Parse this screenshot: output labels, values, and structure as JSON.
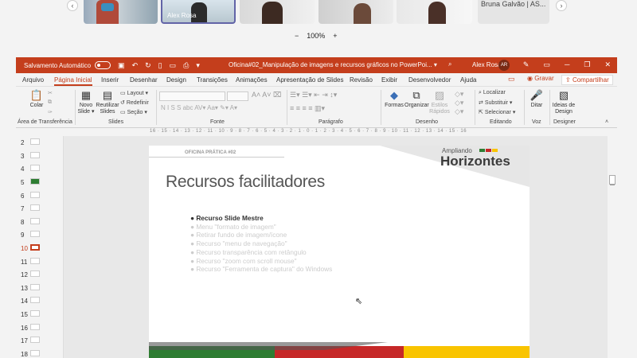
{
  "meeting": {
    "participants": [
      {
        "name": ""
      },
      {
        "name": "Alex Rosa"
      },
      {
        "name": ""
      },
      {
        "name": ""
      },
      {
        "name": ""
      },
      {
        "name": "Bruna Galvão | AS..."
      }
    ],
    "prev_arrow": "‹",
    "next_arrow": "›",
    "zoom_minus": "−",
    "zoom_level": "100%",
    "zoom_plus": "+"
  },
  "window": {
    "autosave_label": "Salvamento Automático",
    "document_title": "Oficina#02_Manipulação de imagens e recursos gráficos no PowerPoi... ▾",
    "user_name": "Alex Rosa",
    "user_initials": "AR"
  },
  "tabs": [
    "Arquivo",
    "Página Inicial",
    "Inserir",
    "Desenhar",
    "Design",
    "Transições",
    "Animações",
    "Apresentação de Slides",
    "Revisão",
    "Exibir",
    "Desenvolvedor",
    "Ajuda"
  ],
  "actions": {
    "record": "Gravar",
    "share": "Compartilhar"
  },
  "ribbon": {
    "paste": "Colar",
    "new_slide": "Novo Slide ▾",
    "reuse_slides": "Reutilizar Slides",
    "layout": "Layout ▾",
    "reset": "Redefinir",
    "section": "Seção ▾",
    "shapes": "Formas",
    "arrange": "Organizar",
    "quick_styles": "Estilos Rápidos",
    "find": "Localizar",
    "replace": "Substituir ▾",
    "select": "Selecionar ▾",
    "dictate": "Ditar",
    "design_ideas": "Ideias de Design",
    "groups": {
      "clipboard": "Área de Transferência",
      "slides": "Slides",
      "font": "Fonte",
      "paragraph": "Parágrafo",
      "drawing": "Desenho",
      "editing": "Editando",
      "voice": "Voz",
      "designer": "Designer"
    }
  },
  "ruler_text": "16 · 15 · 14 · 13 · 12 · 11 · 10 · 9 · 8 · 7 · 6 · 5 · 4 · 3 · 2 · 1 · 0 · 1 · 2 · 3 · 4 · 5 · 6 · 7 · 8 · 9 · 10 · 11 · 12 · 13 · 14 · 15 · 16",
  "thumbnails": [
    "2",
    "3",
    "4",
    "5",
    "6",
    "7",
    "8",
    "9",
    "10",
    "11",
    "12",
    "13",
    "14",
    "15",
    "16",
    "17",
    "18"
  ],
  "selected_slide": "10",
  "slide": {
    "tag": "OFICINA PRÁTICA #02",
    "title": "Recursos facilitadores",
    "logo_top": "Ampliando",
    "logo_main": "Horizontes",
    "bullets": [
      "● Recurso Slide Mestre",
      "● Menu \"formato de imagem\"",
      "● Retirar fundo de imagem/ícone",
      "● Recurso \"menu de navegação\"",
      "● Recurso transparência com retângulo",
      "● Recurso \"zoom com scroll mouse\"",
      "● Recurso \"Ferramenta de captura\" do Windows"
    ],
    "bottom_colors": [
      "#2e7d32",
      "#c62828",
      "#f9c400"
    ],
    "logo_colors": [
      "#2e7d32",
      "#c62828",
      "#f9c400"
    ]
  }
}
